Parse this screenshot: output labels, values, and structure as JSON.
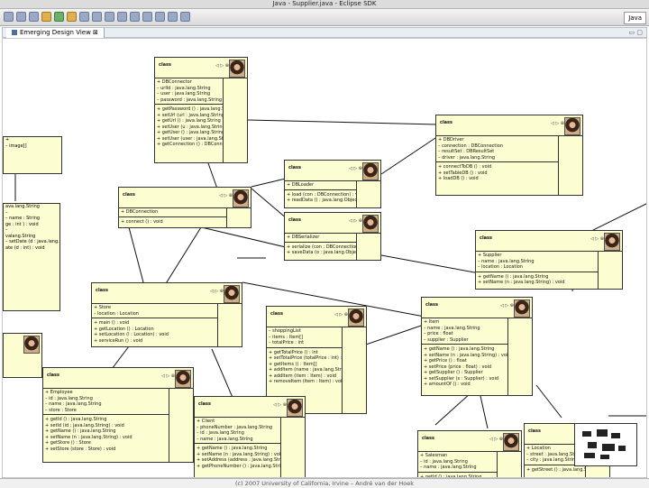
{
  "window": {
    "title": "Java - Supplier.java - Eclipse SDK",
    "perspective": "Java"
  },
  "view": {
    "tab_label": "Emerging Design View",
    "tab_close": "⊠"
  },
  "footer": {
    "text": "(c) 2007 University of California, Irvine – André van der Hoek"
  },
  "boxes": [
    {
      "name": "class",
      "attrs": [
        "+ DBConnector",
        "– urlId : java.lang.String",
        "– user : java.lang.String",
        "– password : java.lang.String"
      ],
      "methods": [
        "+ getPassword () : java.lang.String",
        "+ setUrl (url : java.lang.String) : void",
        "+ getUrl () : java.lang.String",
        "+ setUser (u : java.lang.String) : void",
        "+ getUser () : java.lang.String",
        "+ setUser (user : java.lang.String) : void",
        "+ getConnection () : DBConnection"
      ]
    },
    {
      "name": "class",
      "attrs": [
        "+ DBDriver",
        "– connection : DBConnection",
        "– resultSet : DBResultSet",
        "– driver : java.lang.String"
      ],
      "methods": [
        "+ connectToDB () : void",
        "+ setTableDB () : void",
        "+ loadDB () : void"
      ]
    },
    {
      "name": "class",
      "attrs": [
        "+ DBLoader"
      ],
      "methods": [
        "+ load (con : DBConnection) : void",
        "+ readData () : java.lang.Object"
      ]
    },
    {
      "name": "class",
      "attrs": [
        "+ DBConnection"
      ],
      "methods": [
        "+ connect () : void"
      ]
    },
    {
      "name": "class",
      "attrs": [
        "+ DBSerializer"
      ],
      "methods": [
        "+ serialize (con : DBConnection) : void",
        "+ saveData (o : java.lang.Object) : void"
      ]
    },
    {
      "name": "class",
      "attrs": [
        "+ Supplier",
        "– name : java.lang.String",
        "– location : Location"
      ],
      "methods": [
        "+ getName () : java.lang.String",
        "+ setName (n : java.lang.String) : void"
      ]
    },
    {
      "name": "class",
      "attrs": [
        "+ Store",
        "– location : Location"
      ],
      "methods": [
        "+ main () : void",
        "+ getLocation () : Location",
        "+ setLocation (l : Location) : void",
        "+ serviceRun () : void"
      ]
    },
    {
      "name": "class",
      "attrs": [
        "– shoppingList",
        "– items : Item[]",
        "– totalPrice : int"
      ],
      "methods": [
        "+ getTotalPrice () : int",
        "+ setTotalPrice (totalPrice : int) : void",
        "+ getItems () : Item[]",
        "+ addItem (name : java.lang.String) : void",
        "+ addItem (item : Item) : void",
        "+ removeItem (item : Item) : void"
      ]
    },
    {
      "name": "class",
      "attrs": [
        "+ Item",
        "– name : java.lang.String",
        "– price : float",
        "– supplier : Supplier"
      ],
      "methods": [
        "+ getName () : java.lang.String",
        "+ setName (n : java.lang.String) : void",
        "+ getPrice () : float",
        "+ setPrice (price : float) : void",
        "+ getSupplier () : Supplier",
        "+ setSupplier (s : Supplier) : void",
        "+ amountOf () : void"
      ]
    },
    {
      "name": "class",
      "attrs": [
        "+ Employee",
        "– id : java.lang.String",
        "– name : java.lang.String",
        "– store : Store"
      ],
      "methods": [
        "+ getId () : java.lang.String",
        "+ setId (id : java.lang.String) : void",
        "+ getName () : java.lang.String",
        "+ setName (n : java.lang.String) : void",
        "+ getStore () : Store",
        "+ setStore (store : Store) : void"
      ]
    },
    {
      "name": "class",
      "attrs": [
        "+ Client",
        "– phoneNumber : java.lang.String",
        "– id : java.lang.String",
        "– name : java.lang.String"
      ],
      "methods": [
        "+ getName () : java.lang.String",
        "+ setName (n : java.lang.String) : void",
        "+ setAddress (address : java.lang.String) : void",
        "+ getPhoneNumber () : java.lang.String"
      ]
    },
    {
      "name": "class",
      "attrs": [
        "+ Location",
        "– street : java.lang.String",
        "– city : java.lang.String"
      ],
      "methods": [
        "+ getStreet () : java.lang.String"
      ]
    },
    {
      "name": "class",
      "attrs": [
        "+ Salesman",
        "– id : java.lang.String",
        "– name : java.lang.String"
      ],
      "methods": [
        "+ getId () : java.lang.String"
      ]
    }
  ],
  "fragments": {
    "a": [
      "+",
      "– image[]"
    ],
    "b": [
      "ava.lang.String",
      "– ",
      "– name : String",
      "ge : int ) : void",
      "– ",
      "valang.String",
      "– setDate (d : java.lang.String) : void",
      "ate (d : int) : void"
    ]
  },
  "icons": [
    "new-icon",
    "save-icon",
    "print-icon",
    "debug-icon",
    "run-icon",
    "ext-tools-icon",
    "new-java-project-icon",
    "new-package-icon",
    "new-class-icon",
    "open-type-icon",
    "search-icon",
    "next-annotation-icon",
    "prev-annotation-icon",
    "back-icon",
    "forward-icon"
  ]
}
